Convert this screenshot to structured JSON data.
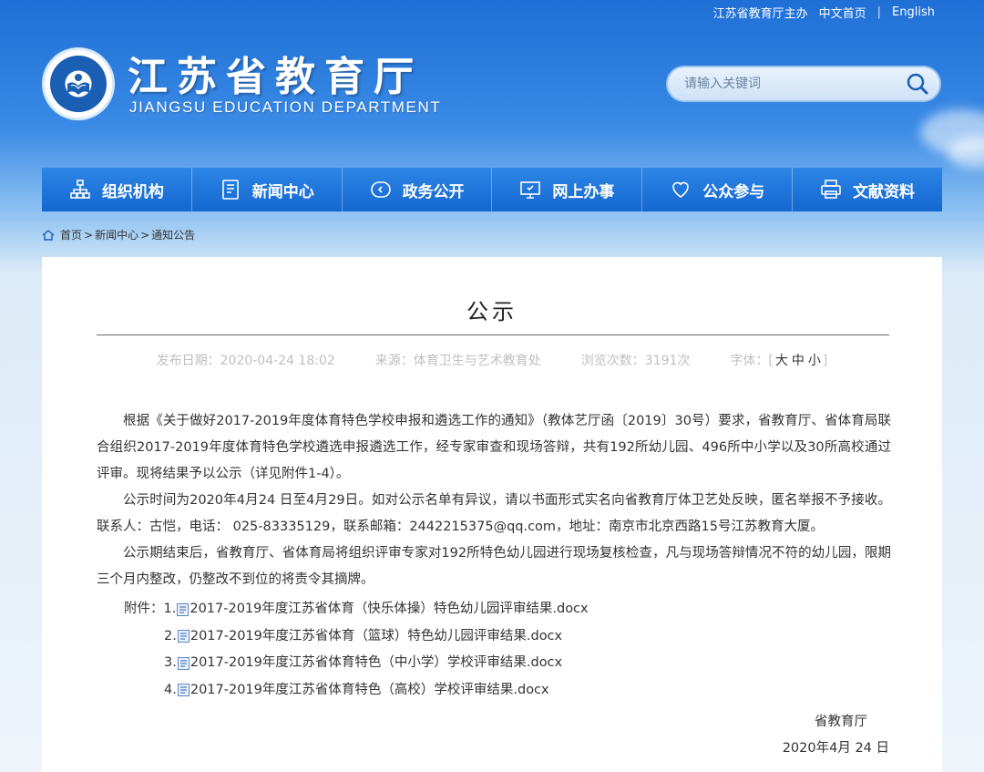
{
  "top_links": {
    "sponsor": "江苏省教育厅主办",
    "home_cn": "中文首页",
    "separator": "|",
    "english": "English"
  },
  "header": {
    "site_name_cn": "江苏省教育厅",
    "site_name_en": "JIANGSU EDUCATION DEPARTMENT"
  },
  "search": {
    "placeholder": "请输入关键词",
    "icon": "search-icon"
  },
  "nav": {
    "items": [
      {
        "label": "组织机构",
        "icon": "org-chart-icon"
      },
      {
        "label": "新闻中心",
        "icon": "document-icon"
      },
      {
        "label": "政务公开",
        "icon": "play-circle-icon"
      },
      {
        "label": "网上办事",
        "icon": "monitor-icon"
      },
      {
        "label": "公众参与",
        "icon": "heart-icon"
      },
      {
        "label": "文献资料",
        "icon": "printer-icon"
      }
    ]
  },
  "breadcrumb": {
    "home": "首页",
    "sep1": ">",
    "news": "新闻中心",
    "sep2": ">",
    "current": "通知公告"
  },
  "article": {
    "title": "公示",
    "meta": {
      "date": "发布日期：2020-04-24 18:02",
      "source": "来源：体育卫生与艺术教育处",
      "views": "浏览次数：3191次",
      "font_label": "字体：[",
      "font_large": "大",
      "font_medium": "中",
      "font_small": "小",
      "font_close": "]"
    },
    "paragraphs": [
      "根据《关于做好2017-2019年度体育特色学校申报和遴选工作的通知》（教体艺厅函〔2019〕30号）要求，省教育厅、省体育局联合组织2017-2019年度体育特色学校遴选申报遴选工作，经专家审查和现场答辩，共有192所幼儿园、496所中小学以及30所高校通过评审。现将结果予以公示（详见附件1-4）。",
      "公示时间为2020年4月24 日至4月29日。如对公示名单有异议，请以书面形式实名向省教育厅体卫艺处反映，匿名举报不予接收。联系人：古恺，电话： 025-83335129，联系邮箱：2442215375@qq.com，地址：南京市北京西路15号江苏教育大厦。",
      "公示期结束后，省教育厅、省体育局将组织评审专家对192所特色幼儿园进行现场复核检查，凡与现场答辩情况不符的幼儿园，限期三个月内整改，仍整改不到位的将责令其摘牌。"
    ],
    "attachments_label": "附件：",
    "attachments": [
      {
        "num": "1.",
        "name": "2017-2019年度江苏省体育（快乐体操）特色幼儿园评审结果.docx"
      },
      {
        "num": "2.",
        "name": "2017-2019年度江苏省体育（篮球）特色幼儿园评审结果.docx"
      },
      {
        "num": "3.",
        "name": "2017-2019年度江苏省体育特色（中小学）学校评审结果.docx"
      },
      {
        "num": "4.",
        "name": "2017-2019年度江苏省体育特色（高校）学校评审结果.docx"
      }
    ],
    "signature": {
      "org": "省教育厅",
      "date": "2020年4月 24 日"
    }
  }
}
